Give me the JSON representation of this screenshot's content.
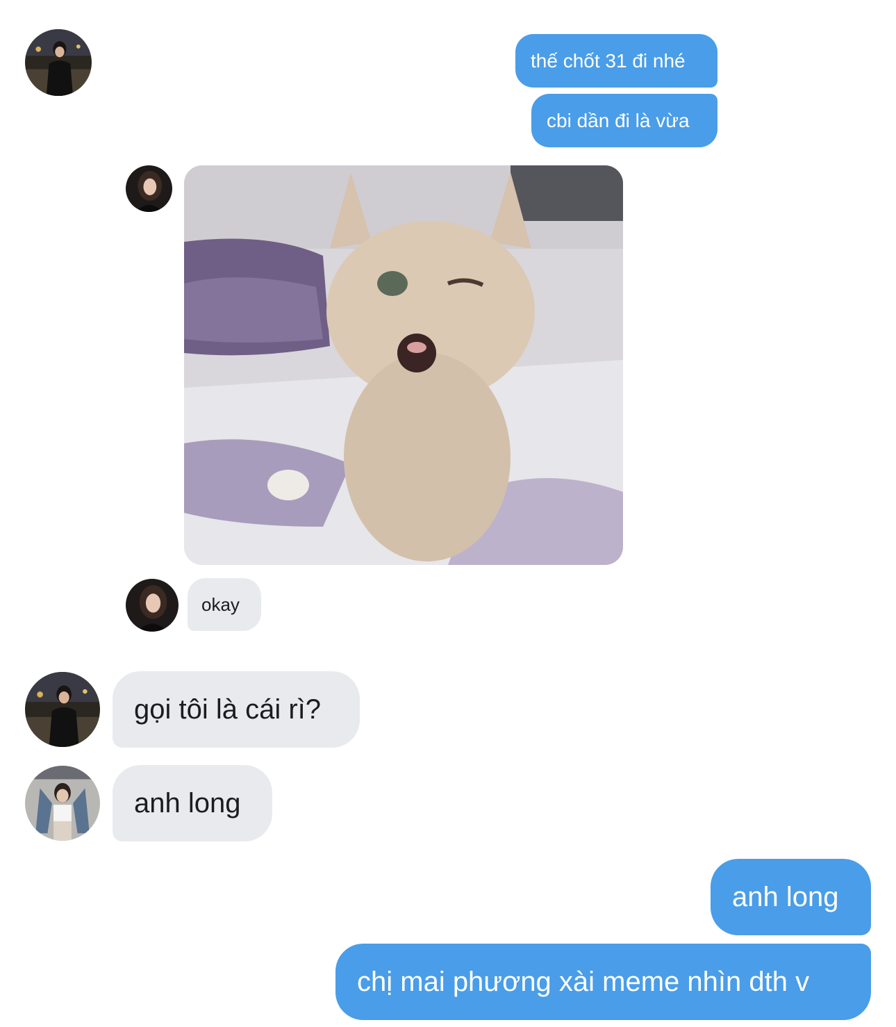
{
  "messages": [
    {
      "id": "m1",
      "direction": "outgoing",
      "text": "thế chốt 31 đi nhé"
    },
    {
      "id": "m2",
      "direction": "outgoing",
      "text": "cbi dần đi là vừa"
    },
    {
      "id": "m3",
      "direction": "incoming",
      "type": "image",
      "image_icon": "winking-kitten-photo"
    },
    {
      "id": "m4",
      "direction": "incoming",
      "text": "okay"
    },
    {
      "id": "m5",
      "direction": "incoming",
      "text": "gọi tôi là cái rì?"
    },
    {
      "id": "m6",
      "direction": "incoming",
      "text": "anh long"
    },
    {
      "id": "m7",
      "direction": "outgoing",
      "text": "anh long"
    },
    {
      "id": "m8",
      "direction": "outgoing",
      "text": "chị mai phương xài meme nhìn dth v"
    }
  ],
  "colors": {
    "outgoing_bubble": "#4a9de8",
    "incoming_bubble": "#e9eaee",
    "outgoing_text": "#ffffff",
    "incoming_text": "#1c1c1e",
    "background": "#ffffff"
  }
}
